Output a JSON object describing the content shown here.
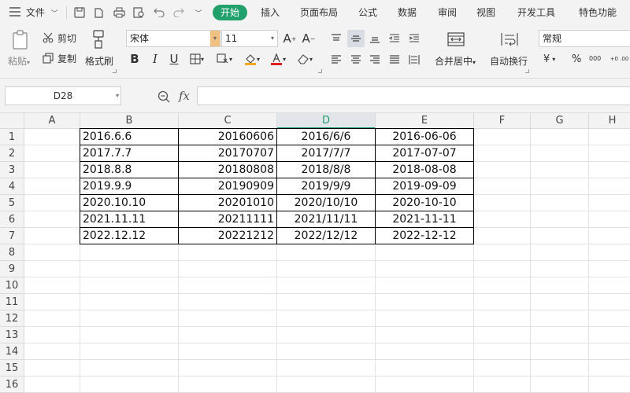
{
  "menubar": {
    "file_label": "文件",
    "tabs": [
      "开始",
      "插入",
      "页面布局",
      "公式",
      "数据",
      "审阅",
      "视图",
      "开发工具",
      "特色功能"
    ],
    "active_tab": "开始"
  },
  "ribbon": {
    "paste_label": "粘贴",
    "cut_label": "剪切",
    "copy_label": "复制",
    "format_painter_label": "格式刷",
    "font_name": "宋体",
    "font_size": "11",
    "merge_center_label": "合并居中",
    "wrap_text_label": "自动换行",
    "number_format": "常规",
    "currency_symbol": "¥",
    "percent_symbol": "%",
    "thousands_symbol": "000",
    "decimal_label": "+0 .00",
    "accent_color": "#22a06b"
  },
  "formula_bar": {
    "name_box": "D28",
    "fx_label": "fx",
    "formula_value": ""
  },
  "sheet": {
    "columns": [
      "A",
      "B",
      "C",
      "D",
      "E",
      "F",
      "G",
      "H"
    ],
    "selected_column": "D",
    "row_numbers": [
      "1",
      "2",
      "3",
      "4",
      "5",
      "6",
      "7",
      "8",
      "9",
      "10",
      "11",
      "12",
      "13",
      "14",
      "15",
      "16"
    ],
    "rows": [
      {
        "B": "2016.6.6",
        "C": "20160606",
        "D": "2016/6/6",
        "E": "2016-06-06"
      },
      {
        "B": "2017.7.7",
        "C": "20170707",
        "D": "2017/7/7",
        "E": "2017-07-07"
      },
      {
        "B": "2018.8.8",
        "C": "20180808",
        "D": "2018/8/8",
        "E": "2018-08-08"
      },
      {
        "B": "2019.9.9",
        "C": "20190909",
        "D": "2019/9/9",
        "E": "2019-09-09"
      },
      {
        "B": "2020.10.10",
        "C": "20201010",
        "D": "2020/10/10",
        "E": "2020-10-10"
      },
      {
        "B": "2021.11.11",
        "C": "20211111",
        "D": "2021/11/11",
        "E": "2021-11-11"
      },
      {
        "B": "2022.12.12",
        "C": "20221212",
        "D": "2022/12/12",
        "E": "2022-12-12"
      }
    ]
  }
}
